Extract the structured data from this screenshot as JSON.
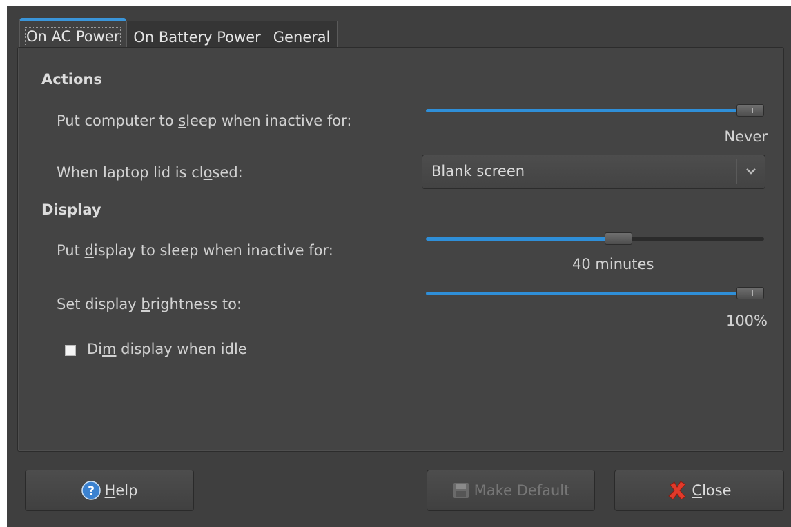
{
  "tabs": [
    {
      "label": "On AC Power",
      "active": true
    },
    {
      "label": "On Battery Power",
      "active": false
    },
    {
      "label": "General",
      "active": false
    }
  ],
  "actions": {
    "title": "Actions",
    "sleep_label_pre": "Put computer to ",
    "sleep_label_mn": "s",
    "sleep_label_post": "leep when inactive for:",
    "sleep_value": "Never",
    "sleep_level": 1.0,
    "lid_label_pre": "When laptop lid is cl",
    "lid_label_mn": "o",
    "lid_label_post": "sed:",
    "lid_selected": "Blank screen"
  },
  "display": {
    "title": "Display",
    "sleep_label_pre": "Put ",
    "sleep_label_mn": "d",
    "sleep_label_post": "isplay to sleep when inactive for:",
    "sleep_value": "40 minutes",
    "sleep_level": 0.57,
    "brightness_label_pre": "Set display ",
    "brightness_label_mn": "b",
    "brightness_label_post": "rightness to:",
    "brightness_value": "100%",
    "brightness_level": 1.0,
    "dim_label_pre": "Di",
    "dim_label_mn": "m",
    "dim_label_post": " display when idle",
    "dim_checked": false
  },
  "buttons": {
    "help_pre": "",
    "help_mn": "H",
    "help_post": "elp",
    "make_default": "Make Default",
    "close_pre": "",
    "close_mn": "C",
    "close_post": "lose"
  },
  "colors": {
    "accent": "#2f8fd8",
    "window_bg": "#3f3f3f",
    "panel_bg": "#444444"
  },
  "icons": {
    "help": "help-icon",
    "make_default": "save-icon",
    "close": "close-icon",
    "combo": "chevron-down-icon"
  }
}
